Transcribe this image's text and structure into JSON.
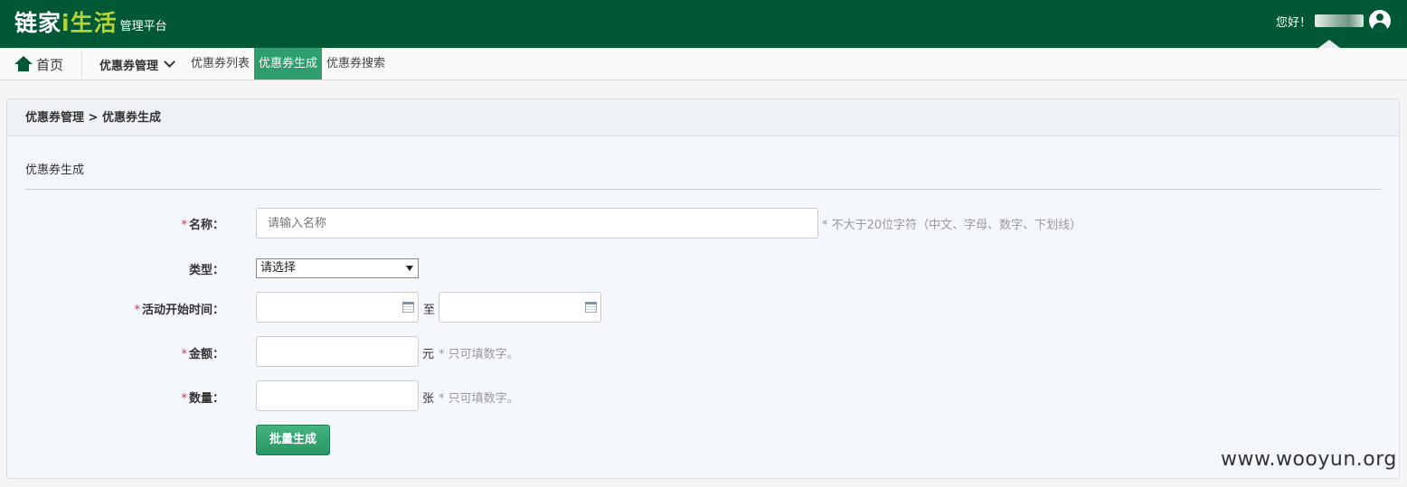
{
  "header": {
    "logo_main": "链家",
    "logo_accent": "i生活",
    "logo_sub": "管理平台",
    "greeting": "您好！"
  },
  "nav": {
    "home_label": "首页",
    "group_label": "优惠券管理",
    "tabs": [
      {
        "label": "优惠券列表",
        "active": false
      },
      {
        "label": "优惠券生成",
        "active": true
      },
      {
        "label": "优惠券搜索",
        "active": false
      }
    ]
  },
  "panel": {
    "breadcrumb": "优惠券管理 > 优惠券生成",
    "section_title": "优惠券生成"
  },
  "form": {
    "required_mark": "*",
    "name": {
      "label": "名称：",
      "placeholder": "请输入名称",
      "hint": "* 不大于20位字符（中文、字母、数字、下划线）"
    },
    "type": {
      "label": "类型：",
      "selected": "请选择"
    },
    "start_time": {
      "label": "活动开始时间：",
      "separator": "至"
    },
    "amount": {
      "label": "金额：",
      "unit": "元",
      "hint": "* 只可填数字。"
    },
    "quantity": {
      "label": "数量：",
      "unit": "张",
      "hint": "* 只可填数字。"
    },
    "submit_label": "批量生成"
  },
  "watermark": "www.wooyun.org",
  "colors": {
    "header_bg": "#005835",
    "accent": "#b5d334",
    "active_tab": "#2e9e6e",
    "required": "#d9333f"
  },
  "icons": {
    "home": "home-icon",
    "calendar": "calendar-icon",
    "avatar": "user-avatar-icon",
    "chevron": "chevron-down-icon"
  }
}
